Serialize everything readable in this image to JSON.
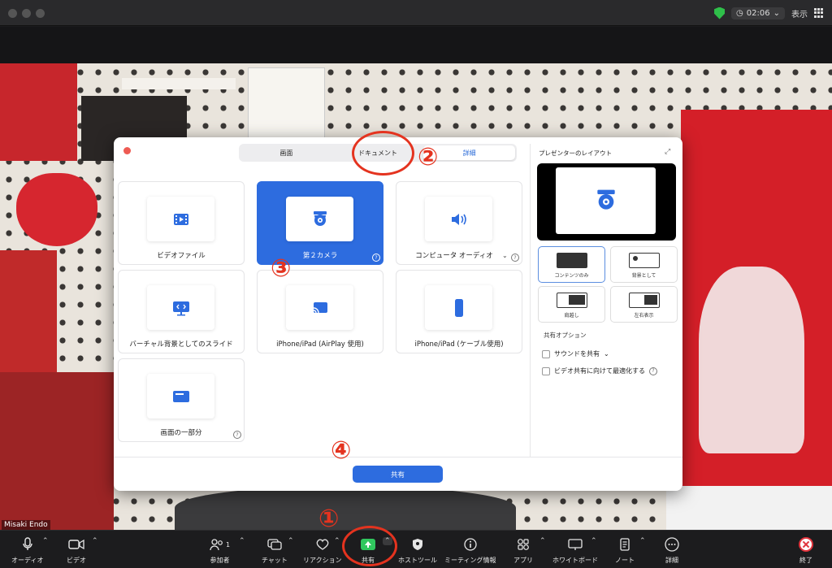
{
  "topbar": {
    "timer": "02:06",
    "view_label": "表示"
  },
  "participant_name": "Misaki Endo",
  "dialog": {
    "tabs": [
      "画面",
      "ドキュメント",
      "詳細"
    ],
    "active_tab": "詳細",
    "cards": [
      {
        "label": "ビデオファイル",
        "icon": "video-file-icon"
      },
      {
        "label": "第２カメラ",
        "icon": "webcam-icon",
        "selected": true
      },
      {
        "label": "コンピュータ オーディオ",
        "icon": "speaker-icon"
      },
      {
        "label": "バーチャル背景としてのスライド",
        "icon": "slides-icon"
      },
      {
        "label": "iPhone/iPad (AirPlay 使用)",
        "icon": "airplay-icon"
      },
      {
        "label": "iPhone/iPad (ケーブル使用)",
        "icon": "phone-icon"
      },
      {
        "label": "画面の一部分",
        "icon": "screen-portion-icon"
      }
    ],
    "help_glyph": "?",
    "share_button": "共有",
    "right_panel": {
      "title": "プレゼンターのレイアウト",
      "layouts": [
        "コンテンツのみ",
        "背景として",
        "肩越し",
        "左右表示"
      ],
      "options_title": "共有オプション",
      "options": [
        "サウンドを共有",
        "ビデオ共有に向けて最適化する"
      ]
    }
  },
  "toolbar": {
    "audio": "オーディオ",
    "video": "ビデオ",
    "participants": "参加者",
    "participants_count": "1",
    "chat": "チャット",
    "reactions": "リアクション",
    "share": "共有",
    "host_tools": "ホストツール",
    "meeting_info": "ミーティング情報",
    "apps": "アプリ",
    "whiteboard": "ホワイトボード",
    "notes": "ノート",
    "more": "詳細",
    "end": "終了"
  },
  "annotations": [
    "①",
    "②",
    "③",
    "④"
  ],
  "colors": {
    "accent": "#2d6cdf",
    "annotation": "#e4331f",
    "share_green": "#30c75e"
  }
}
